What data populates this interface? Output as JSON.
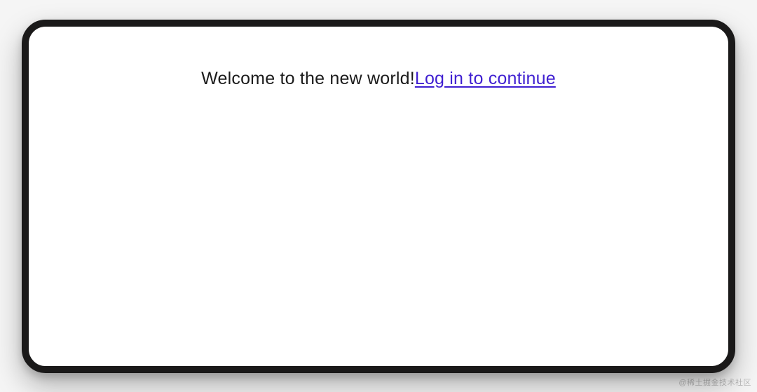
{
  "content": {
    "welcome_text": "Welcome to the new world!",
    "login_link_text": "Log in to continue"
  },
  "watermark": "@稀土掘金技术社区"
}
